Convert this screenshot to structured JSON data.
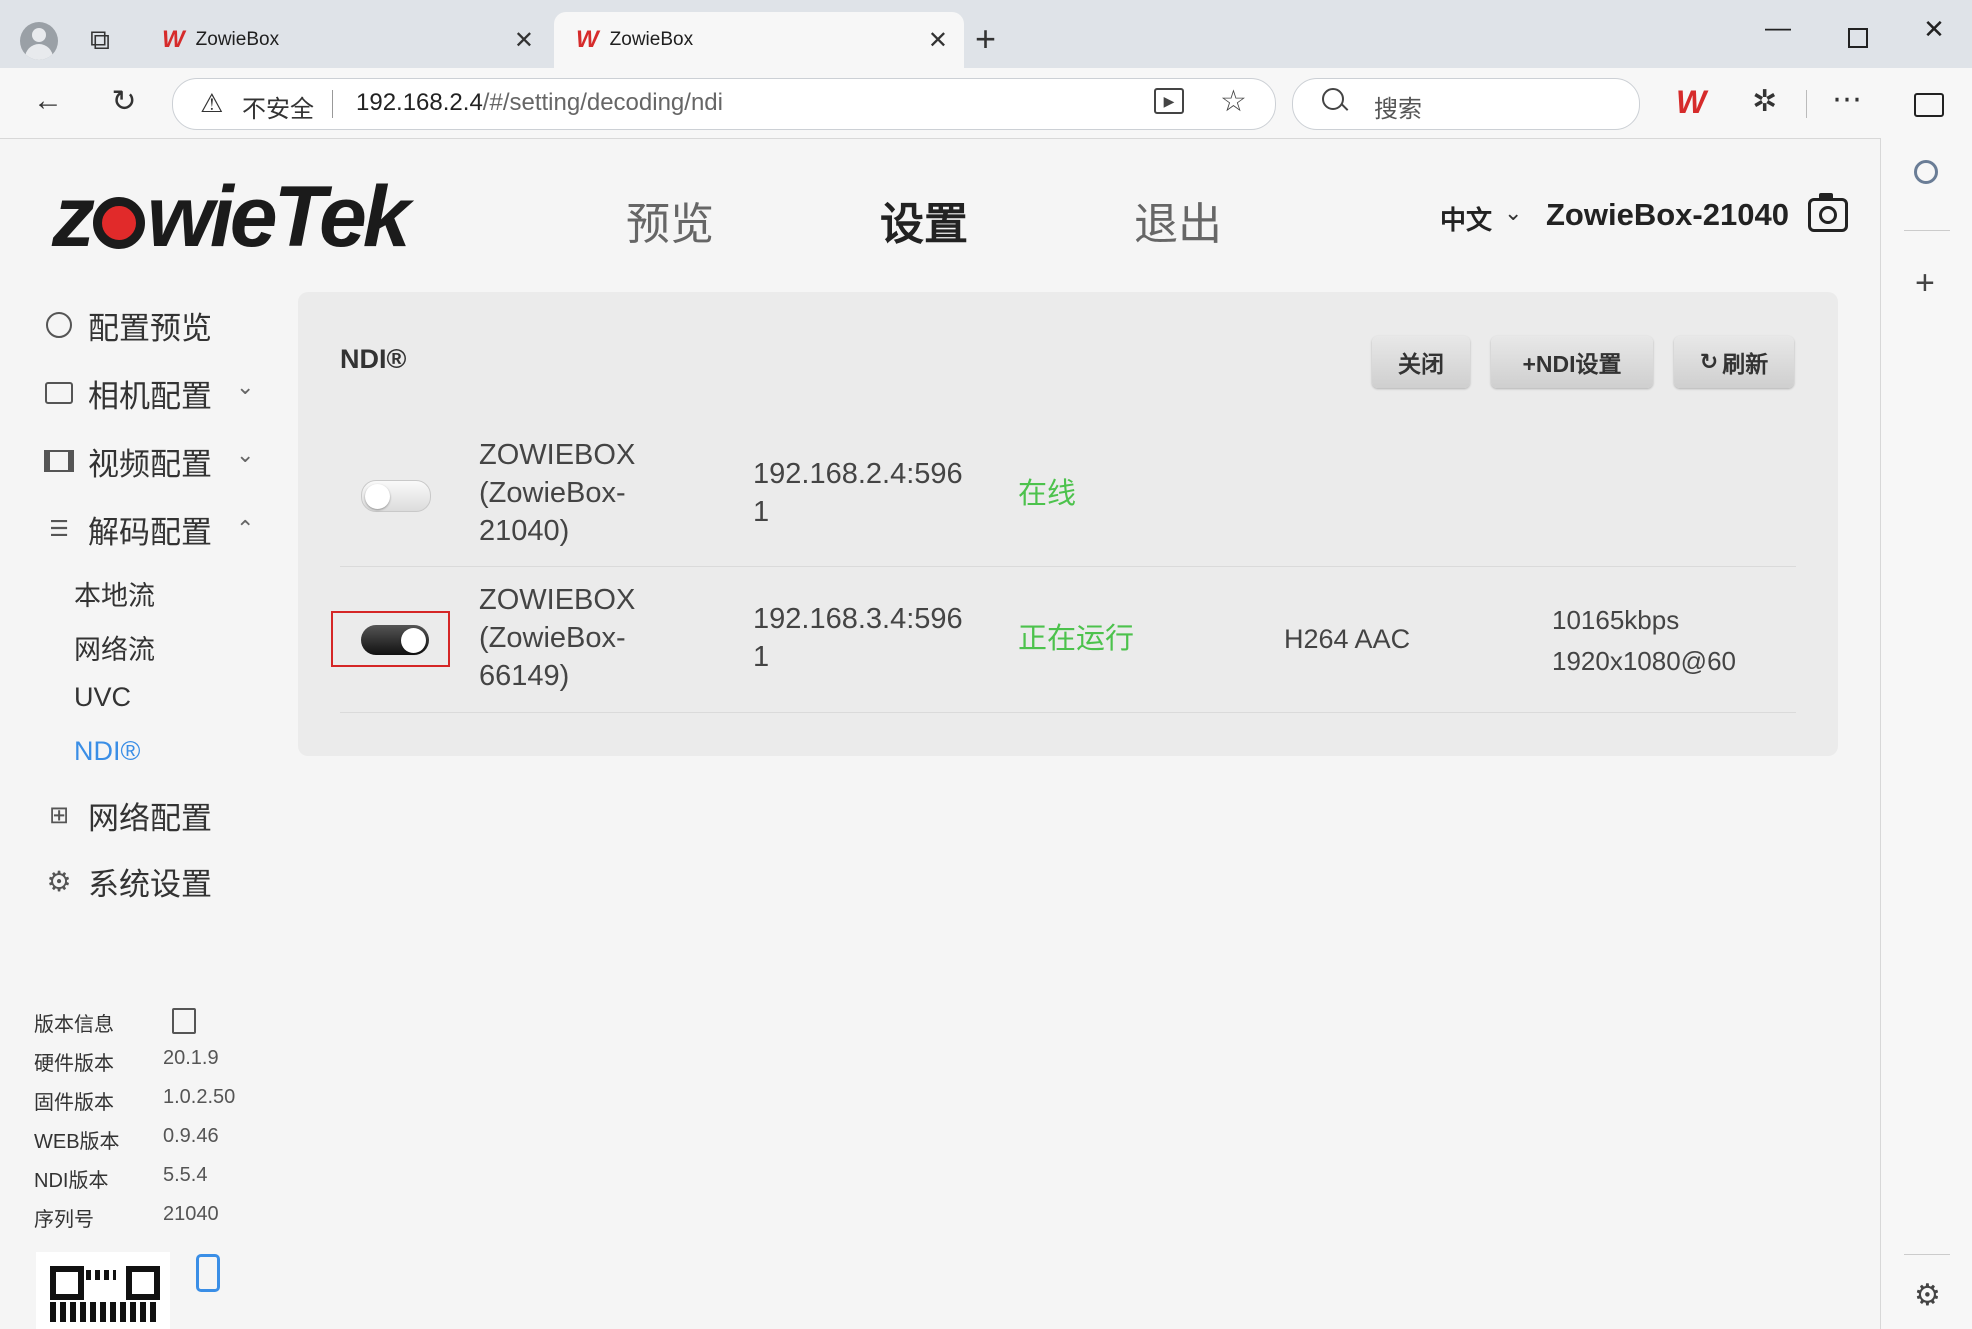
{
  "browser": {
    "tabs": [
      {
        "title": "ZowieBox",
        "active": false
      },
      {
        "title": "ZowieBox",
        "active": true
      }
    ],
    "tab_logo": "W",
    "security_label": "不安全",
    "url_host": "192.168.2.4",
    "url_path": "/#/setting/decoding/ndi",
    "search_placeholder": "搜索"
  },
  "header": {
    "brand_left": "z",
    "brand_right": "wieTek",
    "nav": [
      "预览",
      "设置",
      "退出"
    ],
    "active_nav": "设置",
    "language": "中文",
    "device_name": "ZowieBox-21040"
  },
  "sidebar": {
    "items": [
      {
        "label": "配置预览",
        "icon": "dashboard-icon"
      },
      {
        "label": "相机配置",
        "icon": "camera-icon",
        "chevron": "down"
      },
      {
        "label": "视频配置",
        "icon": "film-icon",
        "chevron": "down"
      },
      {
        "label": "解码配置",
        "icon": "decode-icon",
        "chevron": "up"
      },
      {
        "label": "网络配置",
        "icon": "network-icon"
      },
      {
        "label": "系统设置",
        "icon": "gear-icon"
      }
    ],
    "subitems": [
      "本地流",
      "网络流",
      "UVC",
      "NDI®"
    ],
    "active_subitem": "NDI®"
  },
  "version_info": {
    "title": "版本信息",
    "rows": [
      {
        "label": "硬件版本",
        "value": "20.1.9"
      },
      {
        "label": "固件版本",
        "value": "1.0.2.50"
      },
      {
        "label": "WEB版本",
        "value": "0.9.46"
      },
      {
        "label": "NDI版本",
        "value": "5.5.4"
      },
      {
        "label": "序列号",
        "value": "21040"
      }
    ]
  },
  "ndi": {
    "title": "NDI®",
    "buttons": {
      "close": "关闭",
      "settings": "+NDI设置",
      "refresh": "刷新"
    },
    "rows": [
      {
        "enabled": false,
        "name_lines": [
          "ZOWIEBOX",
          "(ZowieBox-",
          "21040)"
        ],
        "ip_lines": [
          "192.168.2.4:596",
          "1"
        ],
        "status": "在线",
        "codec": "",
        "stats": []
      },
      {
        "enabled": true,
        "highlighted": true,
        "name_lines": [
          "ZOWIEBOX",
          "(ZowieBox-",
          "66149)"
        ],
        "ip_lines": [
          "192.168.3.4:596",
          "1"
        ],
        "status": "正在运行",
        "codec": "H264 AAC",
        "stats": [
          "10165kbps",
          "1920x1080@60"
        ]
      }
    ]
  },
  "colors": {
    "accent": "#3a8ee6",
    "status_green": "#4cc24c",
    "brand_red": "#e12a2a",
    "highlight_red": "#d52626"
  }
}
